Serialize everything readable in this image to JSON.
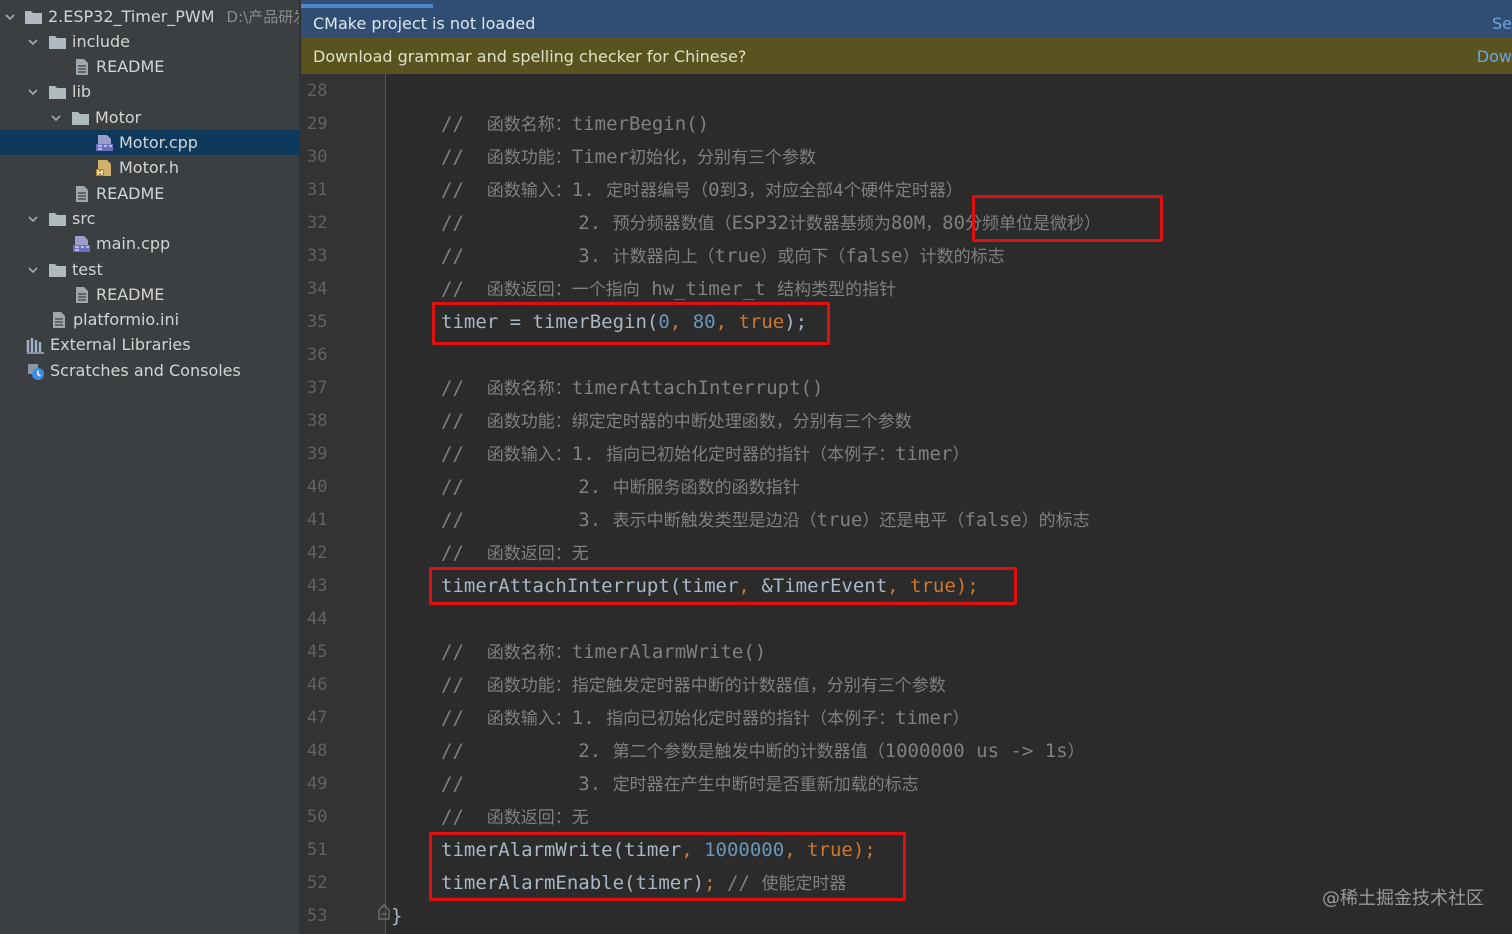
{
  "project_tree": {
    "root": {
      "label": "2.ESP32_Timer_PWM",
      "path_hint": "D:\\产品研发\\"
    },
    "items": [
      {
        "label": "include",
        "type": "folder"
      },
      {
        "label": "README",
        "type": "file"
      },
      {
        "label": "lib",
        "type": "folder"
      },
      {
        "label": "Motor",
        "type": "folder"
      },
      {
        "label": "Motor.cpp",
        "type": "cpp-file",
        "selected": true
      },
      {
        "label": "Motor.h",
        "type": "h-file"
      },
      {
        "label": "README",
        "type": "file"
      },
      {
        "label": "src",
        "type": "folder"
      },
      {
        "label": "main.cpp",
        "type": "cpp-file"
      },
      {
        "label": "test",
        "type": "folder"
      },
      {
        "label": "README",
        "type": "file"
      },
      {
        "label": "platformio.ini",
        "type": "file"
      },
      {
        "label": "External Libraries",
        "type": "libraries"
      },
      {
        "label": "Scratches and Consoles",
        "type": "scratches"
      }
    ]
  },
  "banners": {
    "cmake": {
      "message": "CMake project is not loaded",
      "action": "Se"
    },
    "grammar": {
      "message": "Download grammar and spelling checker for Chinese?",
      "action": "Dow"
    }
  },
  "editor": {
    "line_numbers": [
      "28",
      "29",
      "30",
      "31",
      "32",
      "33",
      "34",
      "35",
      "36",
      "37",
      "38",
      "39",
      "40",
      "41",
      "42",
      "43",
      "44",
      "45",
      "46",
      "47",
      "48",
      "49",
      "50",
      "51",
      "52",
      "53"
    ],
    "lines": {
      "l29": {
        "c1": "//",
        "c2": "函数名称：",
        "c3": "timerBegin()"
      },
      "l30": {
        "c1": "//",
        "c2": "函数功能：",
        "c3": "Timer",
        "c4": "初始化，分别有三个参数"
      },
      "l31": {
        "c1": "//",
        "c2": "函数输入：",
        "c3": "1.",
        "c4": "定时器编号（",
        "c5": "0",
        "c6": "到",
        "c7": "3",
        "c8": "，对应全部4个硬件定时器）"
      },
      "l32": {
        "c1": "//",
        "c2": "2.",
        "c3": "预分频器数值（",
        "c4": "ESP32",
        "c5": "计数器基频为",
        "c6": "80M",
        "c7": "，",
        "c8": "80",
        "c9": "分频单位是微秒）"
      },
      "l33": {
        "c1": "//",
        "c2": "3.",
        "c3": "计数器向上（",
        "c4": "true",
        "c5": "）或向下（",
        "c6": "false",
        "c7": "）计数的标志"
      },
      "l34": {
        "c1": "//",
        "c2": "函数返回：一个指向",
        "c3": "hw_timer_t",
        "c4": "结构类型的指针"
      },
      "l35": {
        "a": "timer = timerBegin(",
        "b": "0",
        "c": ", ",
        "d": "80",
        "e": ", ",
        "f": "true",
        "g": ");"
      },
      "l37": {
        "c1": "//",
        "c2": "函数名称：",
        "c3": "timerAttachInterrupt()"
      },
      "l38": {
        "c1": "//",
        "c2": "函数功能：绑定定时器的中断处理函数，分别有三个参数"
      },
      "l39": {
        "c1": "//",
        "c2": "函数输入：",
        "c3": "1.",
        "c4": "指向已初始化定时器的指针（本例子：",
        "c5": "timer",
        "c6": "）"
      },
      "l40": {
        "c1": "//",
        "c2": "2.",
        "c3": "中断服务函数的函数指针"
      },
      "l41": {
        "c1": "//",
        "c2": "3.",
        "c3": "表示中断触发类型是边沿（",
        "c4": "true",
        "c5": "）还是电平（",
        "c6": "false",
        "c7": "）的标志"
      },
      "l42": {
        "c1": "//",
        "c2": "函数返回：无"
      },
      "l43": {
        "a": "timerAttachInterrupt(timer",
        "b": ", ",
        "c": "&TimerEvent",
        "d": ", ",
        "e": "true",
        "f": ");"
      },
      "l45": {
        "c1": "//",
        "c2": "函数名称：",
        "c3": "timerAlarmWrite()"
      },
      "l46": {
        "c1": "//",
        "c2": "函数功能：指定触发定时器中断的计数器值，分别有三个参数"
      },
      "l47": {
        "c1": "//",
        "c2": "函数输入：",
        "c3": "1.",
        "c4": "指向已初始化定时器的指针（本例子：",
        "c5": "timer",
        "c6": "）"
      },
      "l48": {
        "c1": "//",
        "c2": "2.",
        "c3": "第二个参数是触发中断的计数器值（",
        "c4": "1000000 us -> 1s",
        "c5": "）"
      },
      "l49": {
        "c1": "//",
        "c2": "3.",
        "c3": "定时器在产生中断时是否重新加载的标志"
      },
      "l50": {
        "c1": "//",
        "c2": "函数返回：无"
      },
      "l51": {
        "a": "timerAlarmWrite(timer",
        "b": ", ",
        "c": "1000000",
        "d": ", ",
        "e": "true",
        "f": ");"
      },
      "l52": {
        "a": "timerAlarmEnable(timer)",
        "b": ";",
        "c": " // ",
        "d": "使能定时器"
      },
      "l53": {
        "a": "}"
      }
    }
  },
  "watermark": "@稀土掘金技术社区",
  "colors": {
    "sidebar_bg": "#3c3f41",
    "editor_bg": "#2b2b2b",
    "selection": "#0d3a5c",
    "comment": "#808080",
    "number": "#6897bb",
    "keyword": "#cc7832",
    "highlight_box": "#e01010"
  }
}
